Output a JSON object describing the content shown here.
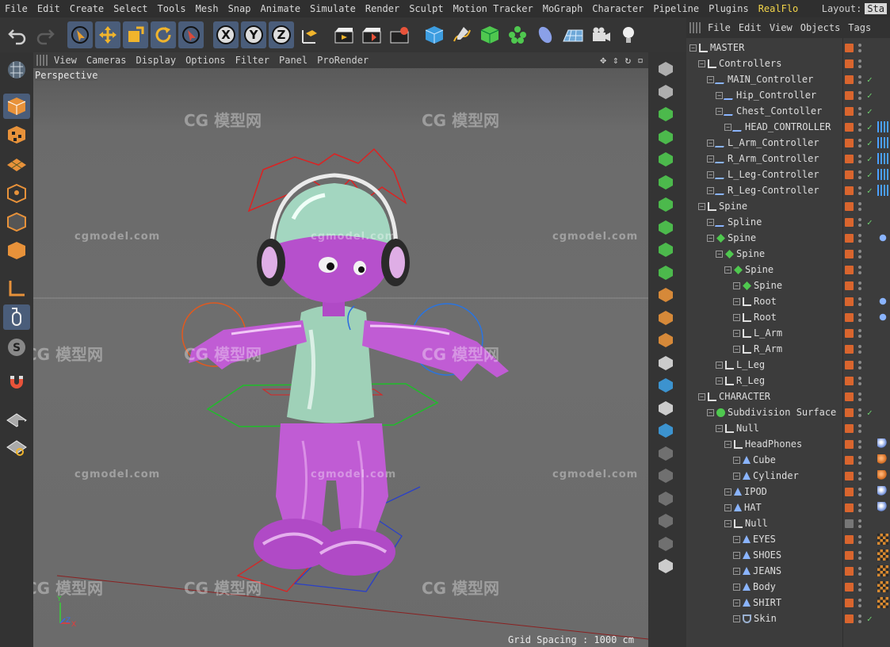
{
  "menubar": {
    "items": [
      "File",
      "Edit",
      "Create",
      "Select",
      "Tools",
      "Mesh",
      "Snap",
      "Animate",
      "Simulate",
      "Render",
      "Sculpt",
      "Motion Tracker",
      "MoGraph",
      "Character",
      "Pipeline",
      "Plugins"
    ],
    "accent_item": "RealFlo",
    "layout_label": "Layout:",
    "layout_value": "Sta"
  },
  "toolbar": {
    "icons": [
      "undo-icon",
      "redo-icon",
      "live-select-icon",
      "move-icon",
      "scale-icon",
      "rotate-icon",
      "select-icon",
      "x-axis-icon",
      "y-axis-icon",
      "z-axis-icon",
      "world-coords-icon",
      "render-view-icon",
      "render-picture-icon",
      "render-settings-icon",
      "cube-icon",
      "pen-icon",
      "subdivision-icon",
      "cloner-icon",
      "deformer-icon",
      "floor-icon",
      "camera-icon",
      "light-icon"
    ],
    "axis_labels": [
      "X",
      "Y",
      "Z"
    ]
  },
  "viewport": {
    "menu": [
      "View",
      "Cameras",
      "Display",
      "Options",
      "Filter",
      "Panel",
      "ProRender"
    ],
    "nav_controls": "✥ ⇕ ↻ ▫",
    "view_name": "Perspective",
    "grid_spacing": "Grid Spacing : 1000 cm",
    "axis": {
      "y": "Y",
      "z": "Z",
      "x": "X"
    },
    "watermark_latin": "cgmodel.com",
    "watermark_cjk": "模型网",
    "watermark_mark": "CG"
  },
  "object_manager": {
    "menu": [
      "File",
      "Edit",
      "View",
      "Objects",
      "Tags"
    ],
    "rows": [
      {
        "name": "MASTER",
        "indent": 0,
        "icon": "null",
        "check": false,
        "tag": ""
      },
      {
        "name": "Controllers",
        "indent": 1,
        "icon": "null",
        "check": false,
        "tag": ""
      },
      {
        "name": "MAIN_Controller",
        "indent": 2,
        "icon": "spline",
        "check": true,
        "tag": ""
      },
      {
        "name": "Hip_Controller",
        "indent": 3,
        "icon": "spline",
        "check": true,
        "tag": ""
      },
      {
        "name": "Chest_Contoller",
        "indent": 3,
        "icon": "spline",
        "check": true,
        "tag": ""
      },
      {
        "name": "HEAD_CONTROLLER",
        "indent": 4,
        "icon": "spline",
        "check": true,
        "tag": "dots"
      },
      {
        "name": "L_Arm_Controller",
        "indent": 2,
        "icon": "spline",
        "check": true,
        "tag": "dots"
      },
      {
        "name": "R_Arm_Controller",
        "indent": 2,
        "icon": "spline",
        "check": true,
        "tag": "dots"
      },
      {
        "name": "L_Leg-Controller",
        "indent": 2,
        "icon": "spline",
        "check": true,
        "tag": "dots"
      },
      {
        "name": "R_Leg-Controller",
        "indent": 2,
        "icon": "spline",
        "check": true,
        "tag": "dots"
      },
      {
        "name": "Spine",
        "indent": 1,
        "icon": "null",
        "check": false,
        "tag": ""
      },
      {
        "name": "Spline",
        "indent": 2,
        "icon": "spline",
        "check": true,
        "tag": ""
      },
      {
        "name": "Spine",
        "indent": 2,
        "icon": "joint",
        "check": false,
        "tag": "ik"
      },
      {
        "name": "Spine",
        "indent": 3,
        "icon": "joint",
        "check": false,
        "tag": ""
      },
      {
        "name": "Spine",
        "indent": 4,
        "icon": "joint",
        "check": false,
        "tag": ""
      },
      {
        "name": "Spine",
        "indent": 5,
        "icon": "joint",
        "check": false,
        "tag": ""
      },
      {
        "name": "Root",
        "indent": 5,
        "icon": "null",
        "check": false,
        "tag": "ik"
      },
      {
        "name": "Root",
        "indent": 5,
        "icon": "null",
        "check": false,
        "tag": "ik"
      },
      {
        "name": "L_Arm",
        "indent": 5,
        "icon": "null",
        "check": false,
        "tag": ""
      },
      {
        "name": "R_Arm",
        "indent": 5,
        "icon": "null",
        "check": false,
        "tag": ""
      },
      {
        "name": "L_Leg",
        "indent": 3,
        "icon": "null",
        "check": false,
        "tag": ""
      },
      {
        "name": "R_Leg",
        "indent": 3,
        "icon": "null",
        "check": false,
        "tag": ""
      },
      {
        "name": "CHARACTER",
        "indent": 1,
        "icon": "null",
        "check": false,
        "tag": ""
      },
      {
        "name": "Subdivision Surface",
        "indent": 2,
        "icon": "subd",
        "check": true,
        "tag": ""
      },
      {
        "name": "Null",
        "indent": 3,
        "icon": "null",
        "check": false,
        "tag": ""
      },
      {
        "name": "HeadPhones",
        "indent": 4,
        "icon": "null",
        "check": false,
        "tag": "mat"
      },
      {
        "name": "Cube",
        "indent": 5,
        "icon": "poly",
        "check": false,
        "tag": "mat2"
      },
      {
        "name": "Cylinder",
        "indent": 5,
        "icon": "poly",
        "check": false,
        "tag": "mat2"
      },
      {
        "name": "IPOD",
        "indent": 4,
        "icon": "poly",
        "check": false,
        "tag": "mat"
      },
      {
        "name": "HAT",
        "indent": 4,
        "icon": "poly",
        "check": false,
        "tag": "mat"
      },
      {
        "name": "Null",
        "indent": 4,
        "icon": "null",
        "check": false,
        "tag": "lock"
      },
      {
        "name": "EYES",
        "indent": 5,
        "icon": "poly",
        "check": false,
        "tag": "checker"
      },
      {
        "name": "SHOES",
        "indent": 5,
        "icon": "poly",
        "check": false,
        "tag": "checker"
      },
      {
        "name": "JEANS",
        "indent": 5,
        "icon": "poly",
        "check": false,
        "tag": "checker"
      },
      {
        "name": "Body",
        "indent": 5,
        "icon": "poly",
        "check": false,
        "tag": "checker"
      },
      {
        "name": "SHIRT",
        "indent": 5,
        "icon": "poly",
        "check": false,
        "tag": "checker"
      },
      {
        "name": "Skin",
        "indent": 5,
        "icon": "skin",
        "check": true,
        "tag": ""
      }
    ]
  },
  "colors": {
    "accent": "#f2d44a",
    "selected_tool": "#4a5d7a",
    "layer_color": "#d9652e",
    "check": "#6fd16f",
    "character": "#c25ad0"
  }
}
